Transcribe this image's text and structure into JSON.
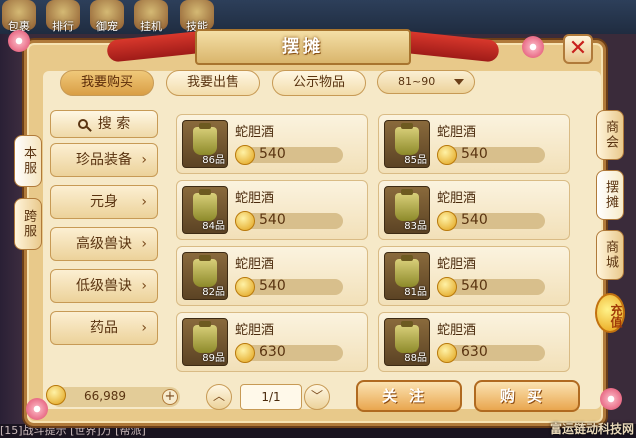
{
  "hud": {
    "icons": [
      {
        "label": "包裹"
      },
      {
        "label": "排行"
      },
      {
        "label": "御宠"
      },
      {
        "label": "挂机"
      },
      {
        "label": "技能"
      }
    ],
    "bottom_text": "[15]战斗提示   [世界]万   [帮派]"
  },
  "title": "摆摊",
  "close_symbol": "✕",
  "tabs": [
    {
      "label": "我要购买",
      "active": true
    },
    {
      "label": "我要出售",
      "active": false
    },
    {
      "label": "公示物品",
      "active": false
    }
  ],
  "level_filter": "81~90",
  "search": {
    "label": "搜 索"
  },
  "categories": [
    {
      "label": "珍品装备"
    },
    {
      "label": "元身"
    },
    {
      "label": "高级兽诀"
    },
    {
      "label": "低级兽诀"
    },
    {
      "label": "药品"
    }
  ],
  "left_tabs": [
    {
      "label": "本服",
      "active": true
    },
    {
      "label": "跨服",
      "active": false
    }
  ],
  "right_tabs": [
    {
      "label": "商会",
      "active": false
    },
    {
      "label": "摆摊",
      "active": true
    },
    {
      "label": "商城",
      "active": false
    }
  ],
  "recharge": "充值",
  "items": [
    {
      "name": "蛇胆酒",
      "level": "86品",
      "price": "540"
    },
    {
      "name": "蛇胆酒",
      "level": "85品",
      "price": "540"
    },
    {
      "name": "蛇胆酒",
      "level": "84品",
      "price": "540"
    },
    {
      "name": "蛇胆酒",
      "level": "83品",
      "price": "540"
    },
    {
      "name": "蛇胆酒",
      "level": "82品",
      "price": "540"
    },
    {
      "name": "蛇胆酒",
      "level": "81品",
      "price": "540"
    },
    {
      "name": "蛇胆酒",
      "level": "89品",
      "price": "630"
    },
    {
      "name": "蛇胆酒",
      "level": "88品",
      "price": "630"
    }
  ],
  "balance": "66,989",
  "pagination": {
    "label": "1/1",
    "prev": "︿",
    "next": "﹀"
  },
  "buttons": {
    "follow": "关注",
    "buy": "购买",
    "plus": "+"
  },
  "watermark": "富运链动科技网",
  "colors": {
    "accent": "#d99e45",
    "title_red": "#c8201c",
    "panel": "#e8c98a"
  }
}
